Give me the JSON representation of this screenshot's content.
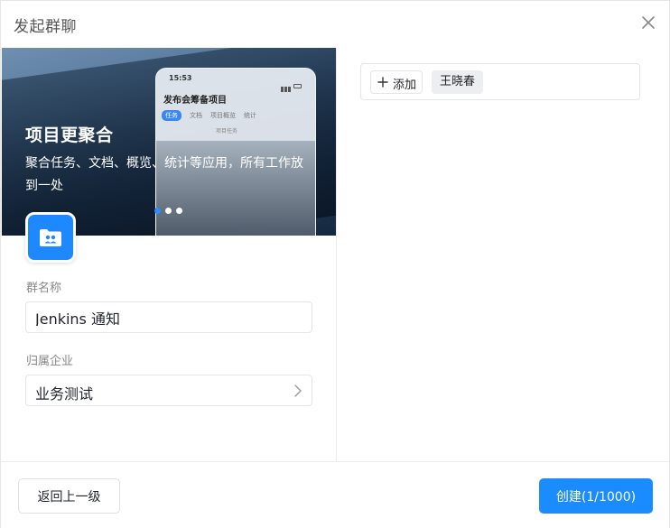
{
  "dialog": {
    "title": "发起群聊",
    "close_icon": "close-icon"
  },
  "banner": {
    "heading": "项目更聚合",
    "description": "聚合任务、文档、概览、统计等应用，所有工作放到一处",
    "slide_count": 3,
    "active_slide": 1,
    "phone": {
      "time": "15:53",
      "project_title": "发布会筹备项目",
      "tabs": [
        "任务",
        "文档",
        "项目概览",
        "统计"
      ],
      "subtitle": "项目任务"
    }
  },
  "group_avatar": {
    "icon": "group-folder-icon",
    "color": "#1e88ff"
  },
  "form": {
    "name_label": "群名称",
    "name_value": "Jenkins 通知",
    "org_label": "归属企业",
    "org_value": "业务测试"
  },
  "members": {
    "add_label": "添加",
    "items": [
      "王晓春"
    ]
  },
  "footer": {
    "back_label": "返回上一级",
    "create_label": "创建(1/1000)",
    "accent": "#1a8cff"
  }
}
